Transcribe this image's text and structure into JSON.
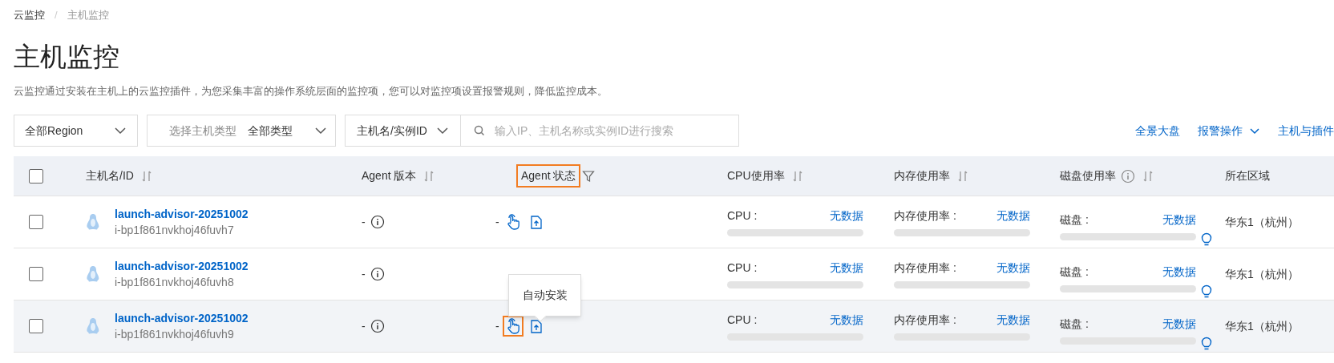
{
  "breadcrumb": {
    "separator": "/",
    "items": [
      {
        "label": "云监控"
      },
      {
        "label": "主机监控"
      }
    ]
  },
  "title": "主机监控",
  "description": "云监控通过安装在主机上的云监控插件，为您采集丰富的操作系统层面的监控项，您可以对监控项设置报警规则，降低监控成本。",
  "filters": {
    "region": "全部Region",
    "host_type_label": "选择主机类型",
    "host_type": "全部类型",
    "search_by": "主机名/实例ID",
    "search_placeholder": "输入IP、主机名称或实例ID进行搜索"
  },
  "actions": [
    {
      "label": "全景大盘",
      "dropdown": false
    },
    {
      "label": "报警操作",
      "dropdown": true
    },
    {
      "label": "主机与插件",
      "dropdown": false
    }
  ],
  "table": {
    "select_all": {
      "checked": false
    },
    "columns": [
      {
        "label": "主机名/ID",
        "highlighted": false,
        "icons": [
          {
            "kind": "sort"
          }
        ]
      },
      {
        "label": "Agent 版本",
        "highlighted": false,
        "icons": [
          {
            "kind": "sort"
          }
        ]
      },
      {
        "label": "Agent 状态",
        "highlighted": true,
        "icons": [
          {
            "kind": "filter"
          }
        ]
      },
      {
        "label": "CPU使用率",
        "highlighted": false,
        "icons": [
          {
            "kind": "sort"
          }
        ]
      },
      {
        "label": "内存使用率",
        "highlighted": false,
        "icons": [
          {
            "kind": "sort"
          }
        ]
      },
      {
        "label": "磁盘使用率",
        "highlighted": false,
        "icons": [
          {
            "kind": "info"
          },
          {
            "kind": "sort"
          }
        ]
      },
      {
        "label": "所在区域",
        "highlighted": false
      }
    ],
    "rows": [
      {
        "checked": false,
        "hovered": false,
        "name": "launch-advisor-20251002",
        "id": "i-bp1f861nvkhoj46fuvh7",
        "agent_version": "-",
        "agent_status": "-",
        "install_highlighted": false,
        "cpu": {
          "label": "CPU :",
          "value": "无数据"
        },
        "memory": {
          "label": "内存使用率 :",
          "value": "无数据"
        },
        "disk": {
          "label": "磁盘 :",
          "value": "无数据"
        },
        "region": "华东1（杭州）"
      },
      {
        "checked": false,
        "hovered": false,
        "name": "launch-advisor-20251002",
        "id": "i-bp1f861nvkhoj46fuvh8",
        "agent_version": "-",
        "cpu": {
          "label": "CPU :",
          "value": "无数据"
        },
        "memory": {
          "label": "内存使用率 :",
          "value": "无数据"
        },
        "disk": {
          "label": "磁盘 :",
          "value": "无数据"
        },
        "region": "华东1（杭州）"
      },
      {
        "checked": false,
        "hovered": true,
        "name": "launch-advisor-20251002",
        "id": "i-bp1f861nvkhoj46fuvh9",
        "agent_version": "-",
        "agent_status": "-",
        "install_highlighted": true,
        "cpu": {
          "label": "CPU :",
          "value": "无数据"
        },
        "memory": {
          "label": "内存使用率 :",
          "value": "无数据"
        },
        "disk": {
          "label": "磁盘 :",
          "value": "无数据"
        },
        "region": "华东1（杭州）"
      }
    ]
  },
  "tooltip": {
    "text": "自动安装"
  }
}
